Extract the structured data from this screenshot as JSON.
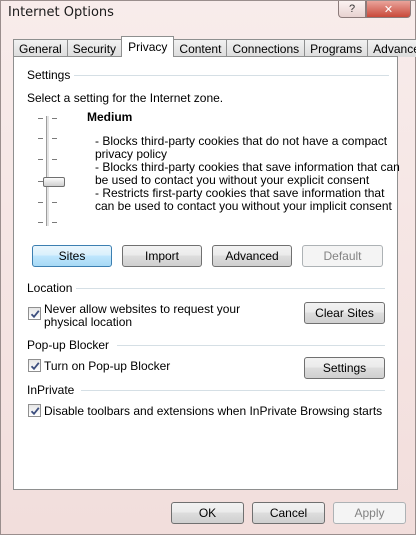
{
  "window": {
    "title": "Internet Options",
    "help_label": "?",
    "close_label": "✕"
  },
  "tabs": [
    {
      "label": "General"
    },
    {
      "label": "Security"
    },
    {
      "label": "Privacy"
    },
    {
      "label": "Content"
    },
    {
      "label": "Connections"
    },
    {
      "label": "Programs"
    },
    {
      "label": "Advanced"
    }
  ],
  "active_tab": "Privacy",
  "settings": {
    "group_label": "Settings",
    "instruction": "Select a setting for the Internet zone.",
    "level_name": "Medium",
    "level_lines": [
      "- Blocks third-party cookies that do not have a compact",
      "privacy policy",
      "- Blocks third-party cookies that save information that can",
      "be used to contact you without your explicit consent",
      "- Restricts first-party cookies that save information that",
      "can be used to contact you without your implicit consent"
    ],
    "slider_level": "Medium",
    "buttons": {
      "sites": "Sites",
      "import": "Import",
      "advanced": "Advanced",
      "default": "Default"
    }
  },
  "location": {
    "group_label": "Location",
    "checkbox_lines": [
      "Never allow websites to request your",
      "physical location"
    ],
    "checked": true,
    "clear_sites": "Clear Sites"
  },
  "popup": {
    "group_label": "Pop-up Blocker",
    "checkbox_label": "Turn on Pop-up Blocker",
    "checked": true,
    "settings": "Settings"
  },
  "inprivate": {
    "group_label": "InPrivate",
    "checkbox_label": "Disable toolbars and extensions when InPrivate Browsing starts",
    "checked": true
  },
  "footer": {
    "ok": "OK",
    "cancel": "Cancel",
    "apply": "Apply"
  }
}
